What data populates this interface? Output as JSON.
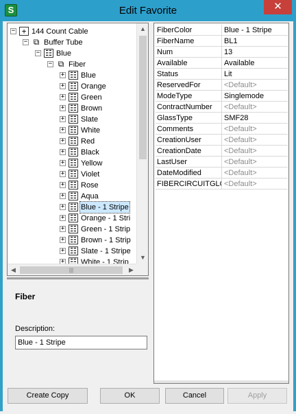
{
  "window": {
    "title": "Edit Favorite",
    "close_glyph": "✕",
    "app_icon_glyph": "S"
  },
  "tree": {
    "root": {
      "label": "144 Count Cable"
    },
    "buffer_tube": {
      "label": "Buffer Tube"
    },
    "blue_tube": {
      "label": "Blue"
    },
    "fiber_group": {
      "label": "Fiber"
    },
    "fibers": [
      {
        "label": "Blue"
      },
      {
        "label": "Orange"
      },
      {
        "label": "Green"
      },
      {
        "label": "Brown"
      },
      {
        "label": "Slate"
      },
      {
        "label": "White"
      },
      {
        "label": "Red"
      },
      {
        "label": "Black"
      },
      {
        "label": "Yellow"
      },
      {
        "label": "Violet"
      },
      {
        "label": "Rose"
      },
      {
        "label": "Aqua"
      },
      {
        "label": "Blue - 1 Stripe"
      },
      {
        "label": "Orange - 1 Stri"
      },
      {
        "label": "Green - 1 Strip"
      },
      {
        "label": "Brown - 1 Strip"
      },
      {
        "label": "Slate - 1 Stripe"
      },
      {
        "label": "White - 1 Strip"
      }
    ],
    "selected_index": 12,
    "hscroll_grip": "|||"
  },
  "description_panel": {
    "heading": "Fiber",
    "label": "Description:",
    "value": "Blue - 1 Stripe"
  },
  "properties": [
    {
      "name": "FiberColor",
      "value": "Blue - 1 Stripe",
      "is_default": false
    },
    {
      "name": "FiberName",
      "value": "BL1",
      "is_default": false
    },
    {
      "name": "Num",
      "value": "13",
      "is_default": false
    },
    {
      "name": "Available",
      "value": "Available",
      "is_default": false
    },
    {
      "name": "Status",
      "value": "Lit",
      "is_default": false
    },
    {
      "name": "ReservedFor",
      "value": "<Default>",
      "is_default": true
    },
    {
      "name": "ModeType",
      "value": "Singlemode",
      "is_default": false
    },
    {
      "name": "ContractNumber",
      "value": "<Default>",
      "is_default": true
    },
    {
      "name": "GlassType",
      "value": "SMF28",
      "is_default": false
    },
    {
      "name": "Comments",
      "value": "<Default>",
      "is_default": true
    },
    {
      "name": "CreationUser",
      "value": "<Default>",
      "is_default": true
    },
    {
      "name": "CreationDate",
      "value": "<Default>",
      "is_default": true
    },
    {
      "name": "LastUser",
      "value": "<Default>",
      "is_default": true
    },
    {
      "name": "DateModified",
      "value": "<Default>",
      "is_default": true
    },
    {
      "name": "FIBERCIRCUITGLO",
      "value": "<Default>",
      "is_default": true
    }
  ],
  "buttons": {
    "create_copy": "Create Copy",
    "ok": "OK",
    "cancel": "Cancel",
    "apply": "Apply"
  },
  "colors": {
    "titlebar": "#2d9fcb",
    "close": "#c7403a",
    "selection": "#cce8ff",
    "default_value": "#8a8a8a"
  }
}
